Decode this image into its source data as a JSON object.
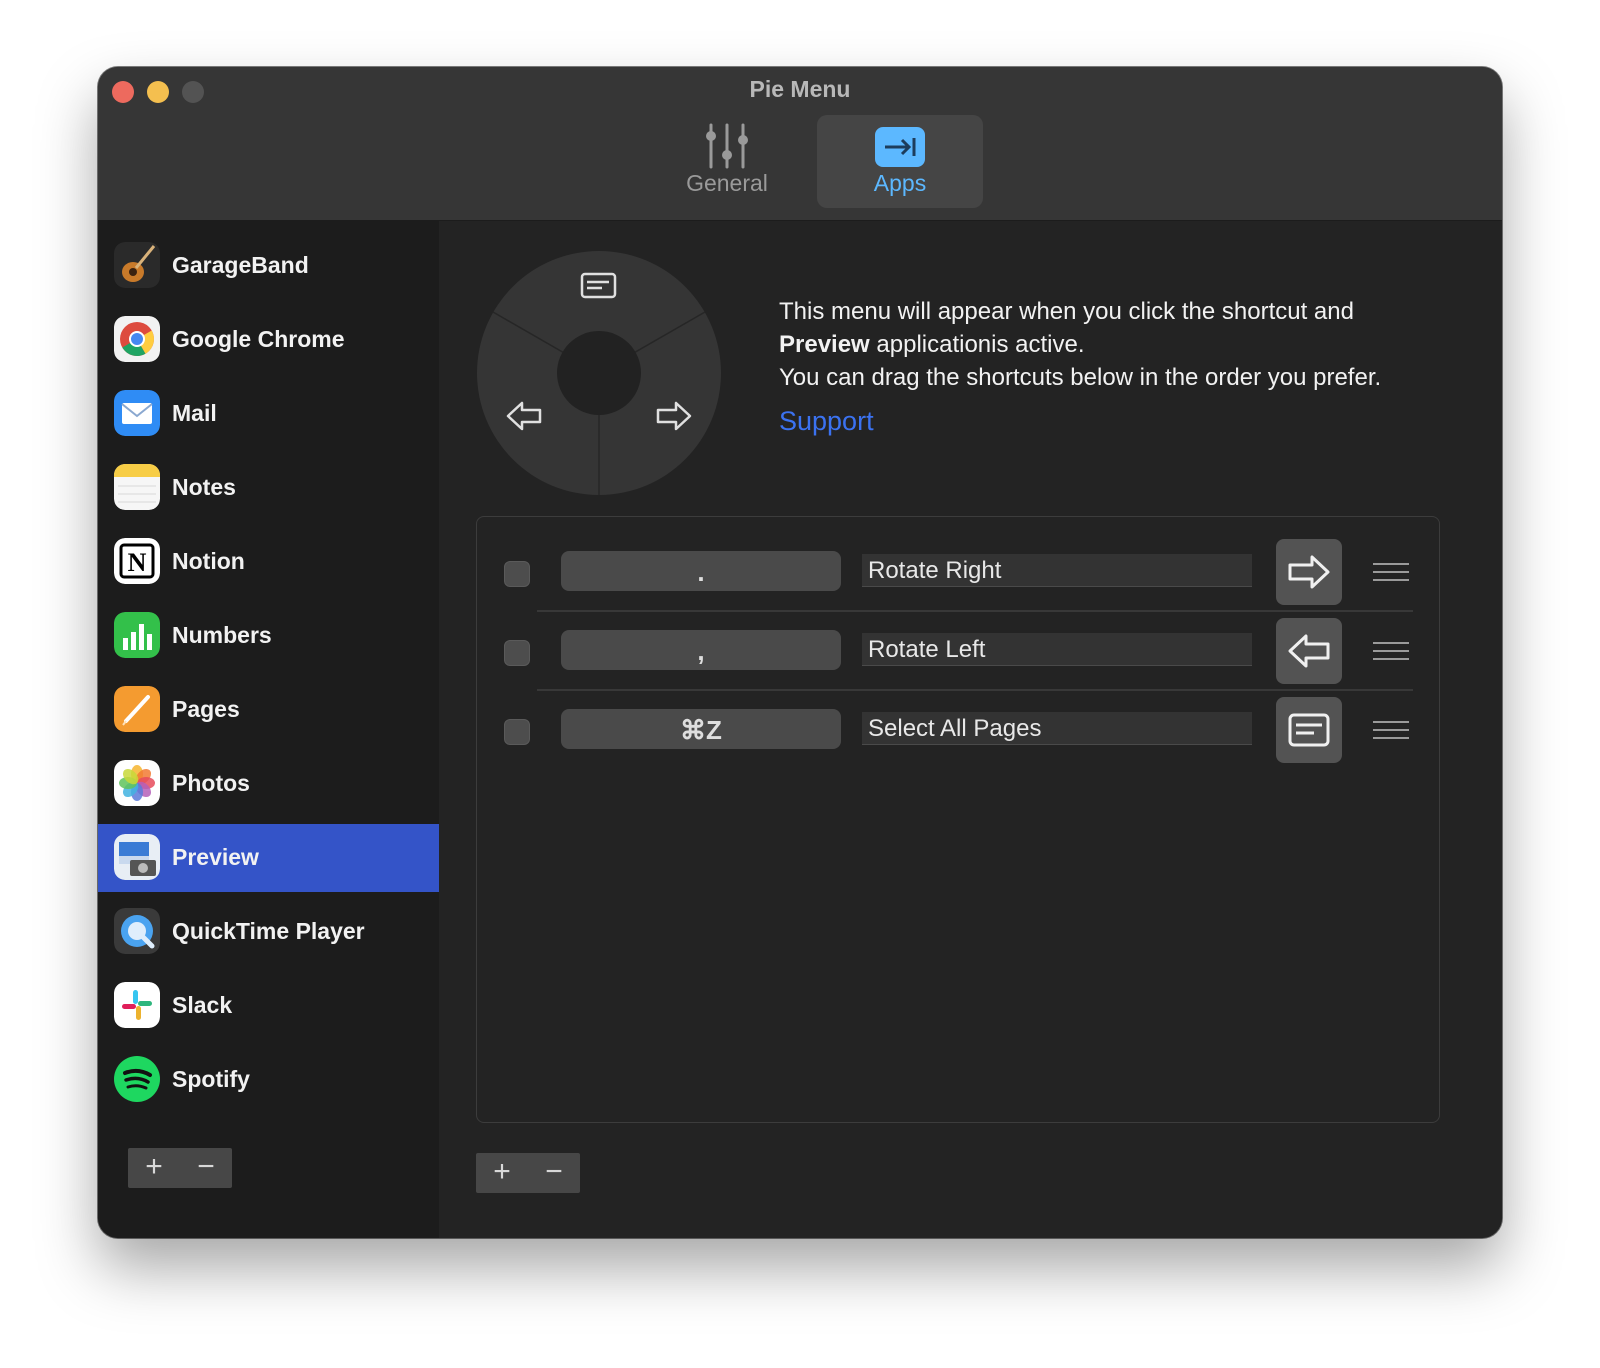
{
  "window": {
    "title": "Pie Menu"
  },
  "toolbar": {
    "tabs": [
      {
        "label": "General",
        "icon": "sliders-icon",
        "selected": false
      },
      {
        "label": "Apps",
        "icon": "apps-tab-icon",
        "selected": true
      }
    ]
  },
  "sidebar": {
    "items": [
      {
        "label": "GarageBand",
        "icon": "garageband-icon"
      },
      {
        "label": "Google Chrome",
        "icon": "chrome-icon"
      },
      {
        "label": "Mail",
        "icon": "mail-icon"
      },
      {
        "label": "Notes",
        "icon": "notes-icon"
      },
      {
        "label": "Notion",
        "icon": "notion-icon"
      },
      {
        "label": "Numbers",
        "icon": "numbers-icon"
      },
      {
        "label": "Pages",
        "icon": "pages-icon"
      },
      {
        "label": "Photos",
        "icon": "photos-icon"
      },
      {
        "label": "Preview",
        "icon": "preview-icon",
        "selected": true
      },
      {
        "label": "QuickTime Player",
        "icon": "quicktime-icon"
      },
      {
        "label": "Slack",
        "icon": "slack-icon"
      },
      {
        "label": "Spotify",
        "icon": "spotify-icon"
      }
    ],
    "add_label": "+",
    "remove_label": "−"
  },
  "main": {
    "info_line1": "This menu will appear when you click the shortcut and",
    "info_app": "Preview",
    "info_line2_rest": " applicationis active.",
    "info_line3": "You can drag the shortcuts below in the order you prefer.",
    "support_label": "Support",
    "shortcuts": [
      {
        "key": ".",
        "name": "Rotate Right",
        "icon": "arrow-right-icon",
        "checked": false
      },
      {
        "key": ",",
        "name": "Rotate Left",
        "icon": "arrow-left-icon",
        "checked": false
      },
      {
        "key": "⌘Z",
        "name": "Select All Pages",
        "icon": "select-all-icon",
        "checked": false
      }
    ],
    "add_label": "+",
    "remove_label": "−"
  },
  "colors": {
    "accent": "#3454c8",
    "link": "#3b72f0",
    "tab_selected": "#5cb8ff"
  }
}
